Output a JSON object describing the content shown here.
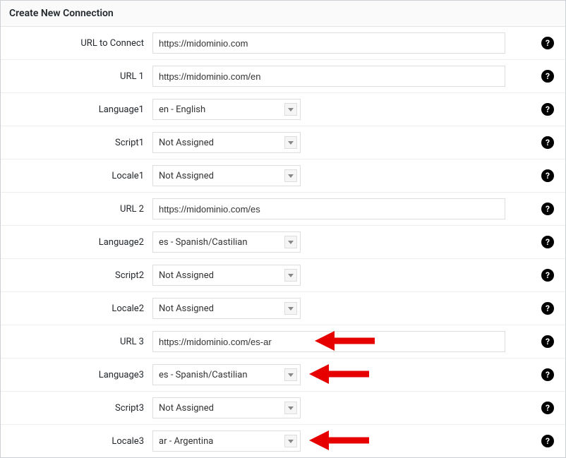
{
  "panel": {
    "title": "Create New Connection"
  },
  "rows": [
    {
      "label": "URL to Connect",
      "type": "text",
      "value": "https://midominio.com",
      "arrow": false
    },
    {
      "label": "URL 1",
      "type": "text",
      "value": "https://midominio.com/en",
      "arrow": false
    },
    {
      "label": "Language1",
      "type": "select",
      "value": "en - English",
      "arrow": false
    },
    {
      "label": "Script1",
      "type": "select",
      "value": "Not Assigned",
      "arrow": false
    },
    {
      "label": "Locale1",
      "type": "select",
      "value": "Not Assigned",
      "arrow": false
    },
    {
      "label": "URL 2",
      "type": "text",
      "value": "https://midominio.com/es",
      "arrow": false
    },
    {
      "label": "Language2",
      "type": "select",
      "value": "es - Spanish/Castilian",
      "arrow": false
    },
    {
      "label": "Script2",
      "type": "select",
      "value": "Not Assigned",
      "arrow": false
    },
    {
      "label": "Locale2",
      "type": "select",
      "value": "Not Assigned",
      "arrow": false
    },
    {
      "label": "URL 3",
      "type": "text",
      "value": "https://midominio.com/es-ar",
      "arrow": true
    },
    {
      "label": "Language3",
      "type": "select",
      "value": "es - Spanish/Castilian",
      "arrow": true
    },
    {
      "label": "Script3",
      "type": "select",
      "value": "Not Assigned",
      "arrow": false
    },
    {
      "label": "Locale3",
      "type": "select",
      "value": "ar - Argentina",
      "arrow": true
    }
  ]
}
